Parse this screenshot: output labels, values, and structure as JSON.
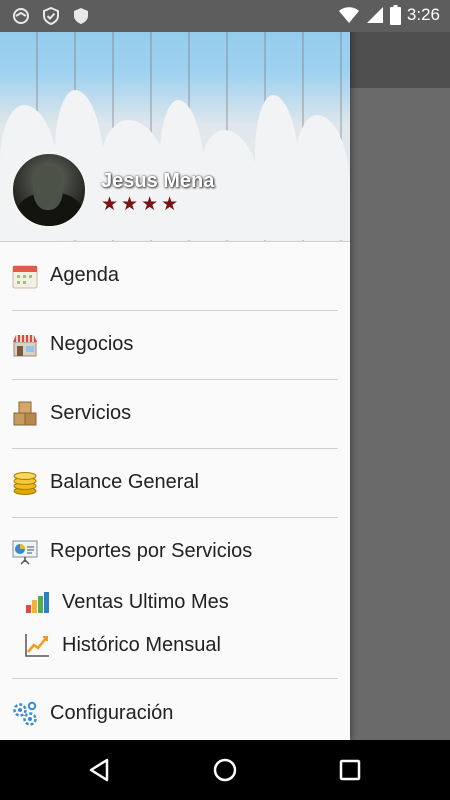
{
  "status_bar": {
    "time": "3:26",
    "left_icons": [
      "sync-icon",
      "shield-check-icon",
      "shield-icon"
    ],
    "right_icons": [
      "wifi-icon",
      "signal-icon",
      "battery-icon"
    ]
  },
  "drawer": {
    "user": {
      "name": "Jesus Mena",
      "rating": 4
    },
    "menu": [
      {
        "label": "Agenda",
        "icon": "calendar-icon"
      },
      {
        "label": "Negocios",
        "icon": "store-icon"
      },
      {
        "label": "Servicios",
        "icon": "boxes-icon"
      },
      {
        "label": "Balance General",
        "icon": "coins-icon"
      },
      {
        "label": "Reportes por Servicios",
        "icon": "presentation-chart-icon"
      }
    ],
    "submenu": [
      {
        "label": "Ventas Ultimo Mes",
        "icon": "bar-chart-icon"
      },
      {
        "label": "Histórico Mensual",
        "icon": "line-chart-icon"
      }
    ],
    "settings": {
      "label": "Configuración",
      "icon": "gears-icon"
    }
  },
  "navigation_bar": {
    "buttons": [
      "back-icon",
      "home-icon",
      "recents-icon"
    ]
  },
  "colors": {
    "star": "#7a1313",
    "header_sky": "#8ec8ec",
    "drawer_bg": "#fafafa"
  }
}
